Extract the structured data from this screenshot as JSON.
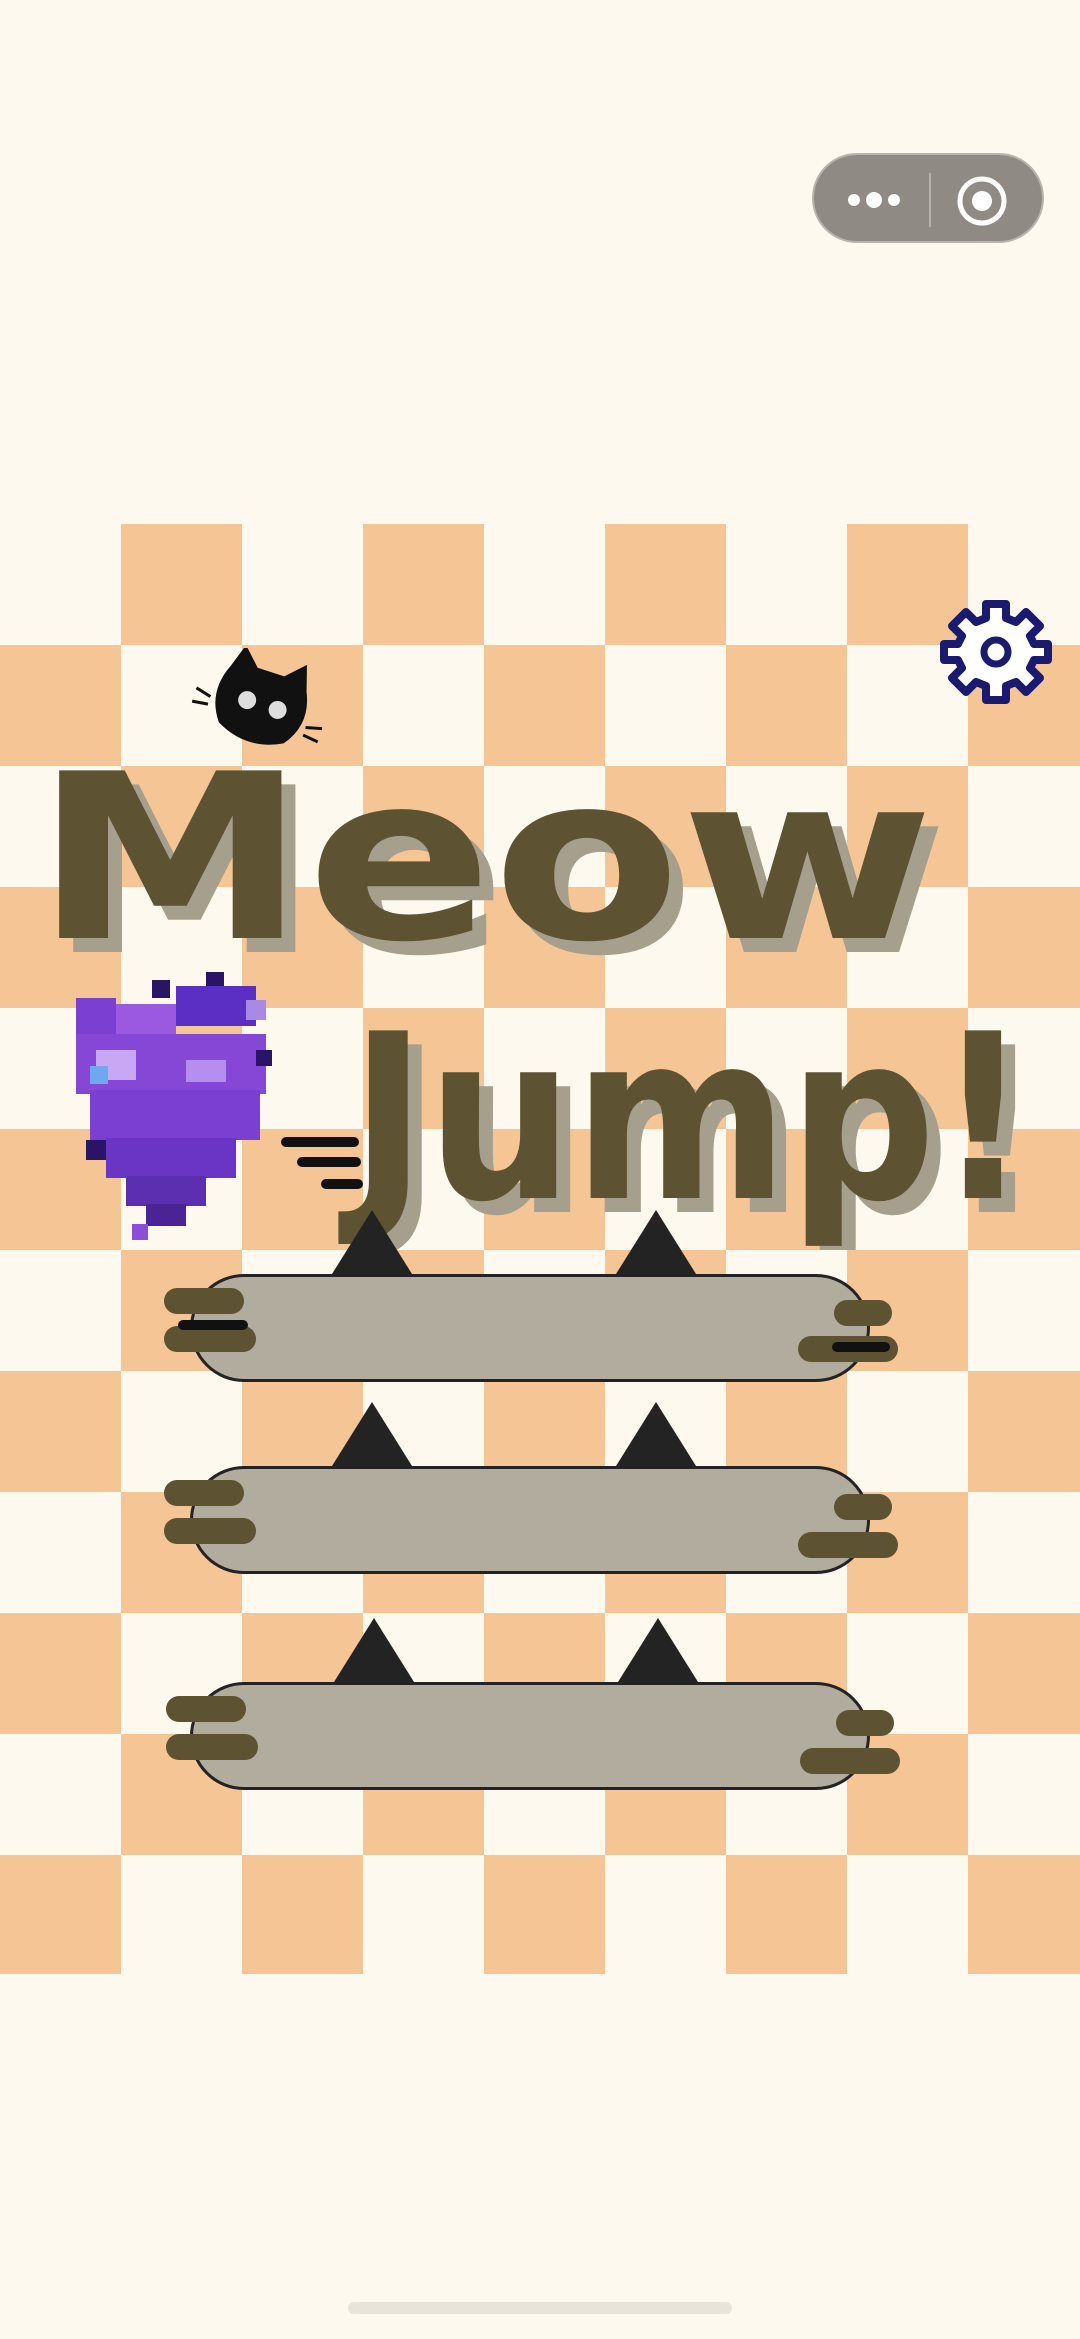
{
  "game": {
    "title_line1": "Meow",
    "title_line2": "Jump!",
    "buttons": [
      {
        "name": "menu-button-1",
        "label": ""
      },
      {
        "name": "menu-button-2",
        "label": ""
      },
      {
        "name": "menu-button-3",
        "label": ""
      }
    ]
  },
  "capsule": {
    "more_icon": "more-dots-icon",
    "close_icon": "target-close-icon"
  },
  "icons": {
    "settings": "gear-icon",
    "cat": "black-cat-icon",
    "heart": "pixel-heart-icon"
  },
  "colors": {
    "background": "#fdf9ee",
    "checker_orange": "#f5c595",
    "title_brown": "#5d5333",
    "button_gray": "#b1ac9d",
    "gear_navy": "#1a1a6e",
    "heart_purple": "#7b3fd1"
  }
}
